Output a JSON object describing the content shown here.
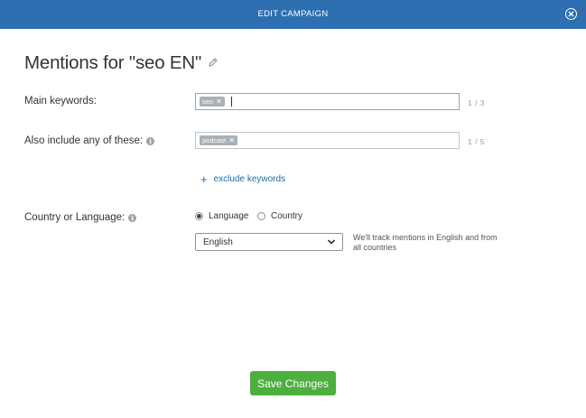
{
  "header": {
    "title": "EDIT CAMPAIGN",
    "close_icon": "close-circle-icon"
  },
  "page": {
    "title": "Mentions for \"seo EN\"",
    "edit_icon": "pencil-icon"
  },
  "main_keywords": {
    "label": "Main keywords:",
    "chips": [
      "seo"
    ],
    "count": "1 / 3"
  },
  "also_include": {
    "label": "Also include any of these:",
    "chips": [
      "podcast"
    ],
    "count": "1 / 5"
  },
  "exclude": {
    "label": "exclude keywords"
  },
  "country_language": {
    "label": "Country or Language:",
    "radio_language": "Language",
    "radio_country": "Country",
    "selected": "Language",
    "select_value": "English",
    "hint": "We'll track mentions in English and from all countries"
  },
  "footer": {
    "save_label": "Save Changes"
  },
  "colors": {
    "header": "#2d6fb0",
    "save": "#4caf3f",
    "link": "#1d6ca6",
    "chip": "#a9b1b7"
  }
}
